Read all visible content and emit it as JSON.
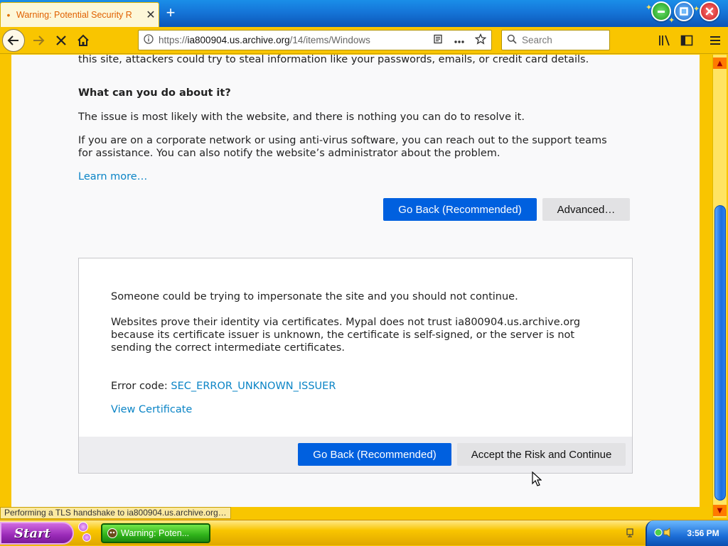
{
  "tab": {
    "title": "Warning: Potential Security R",
    "dot": "•",
    "close": "✕",
    "new_tab": "+"
  },
  "nav": {
    "url_scheme": "https://",
    "url_host": "ia800904.us.archive.org",
    "url_path": "/14/items/Windows",
    "search_placeholder": "Search"
  },
  "icons": {
    "back": "arrow-left-icon",
    "forward": "arrow-right-icon",
    "stop": "stop-x-icon",
    "home": "home-icon",
    "info": "info-circle-icon",
    "reader": "reader-view-icon",
    "more": "page-actions-more-icon",
    "bookmark": "star-icon",
    "search": "search-icon",
    "library": "library-icon",
    "sidebar": "sidebar-icon",
    "menu": "hamburger-menu-icon"
  },
  "content": {
    "cut_line": "this site, attackers could try to steal information like your passwords, emails, or credit card details.",
    "heading": "What can you do about it?",
    "para1": "The issue is most likely with the website, and there is nothing you can do to resolve it.",
    "para2_line1": "If you are on a corporate network or using anti-virus software, you can reach out to the support teams",
    "para2_line2": "for assistance. You can also notify the website’s administrator about the problem.",
    "learn_more": "Learn more…",
    "go_back": "Go Back (Recommended)",
    "advanced": "Advanced…"
  },
  "advanced_panel": {
    "line1": "Someone could be trying to impersonate the site and you should not continue.",
    "line2a": "Websites prove their identity via certificates. Mypal does not trust ia800904.us.archive.org",
    "line2b": "because its certificate issuer is unknown, the certificate is self-signed, or the server is not",
    "line2c": "sending the correct intermediate certificates.",
    "error_label": "Error code: ",
    "error_code": "SEC_ERROR_UNKNOWN_ISSUER",
    "view_certificate": "View Certificate",
    "go_back": "Go Back (Recommended)",
    "accept": "Accept the Risk and Continue"
  },
  "status": "Performing a TLS handshake to ia800904.us.archive.org…",
  "taskbar": {
    "start": "Start",
    "task_title": "Warning: Poten...",
    "clock": "3:56 PM"
  },
  "colors": {
    "primary_button": "#0060df",
    "link": "#0a84c6",
    "chrome_yellow": "#f9c500",
    "tab_blue": "#1575d8"
  }
}
